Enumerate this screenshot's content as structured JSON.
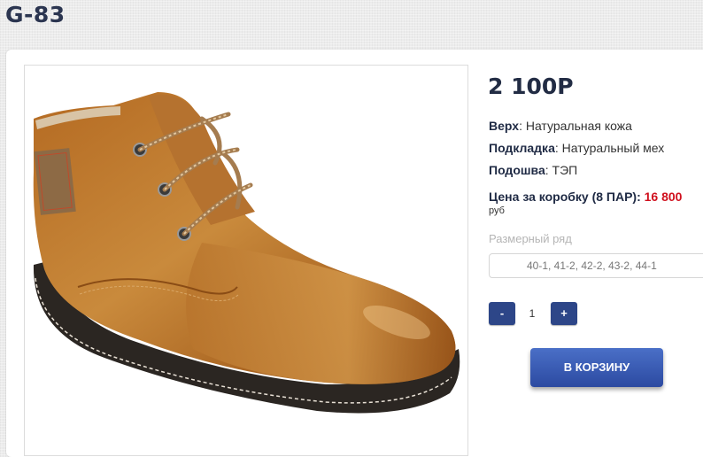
{
  "product": {
    "title": "G-83",
    "price": "2 100Р"
  },
  "specs": [
    {
      "label": "Верх",
      "value": ": Натуральная кожа"
    },
    {
      "label": "Подкладка",
      "value": ": Натуральный мех"
    },
    {
      "label": "Подошва",
      "value": ": ТЭП"
    }
  ],
  "box": {
    "label": "Цена за коробку (8 ПАР): ",
    "amount": "16 800",
    "currency": "руб"
  },
  "sizes": {
    "label": "Размерный ряд",
    "selected": "40-1, 41-2, 42-2, 43-2, 44-1"
  },
  "quantity": {
    "minus": "-",
    "value": "1",
    "plus": "+"
  },
  "cart_button": "В КОРЗИНУ",
  "image": {
    "icon": "brown-leather-ankle-boot"
  },
  "colors": {
    "accent": "#2d4688",
    "price_red": "#d0101e",
    "title": "#2b3550"
  }
}
